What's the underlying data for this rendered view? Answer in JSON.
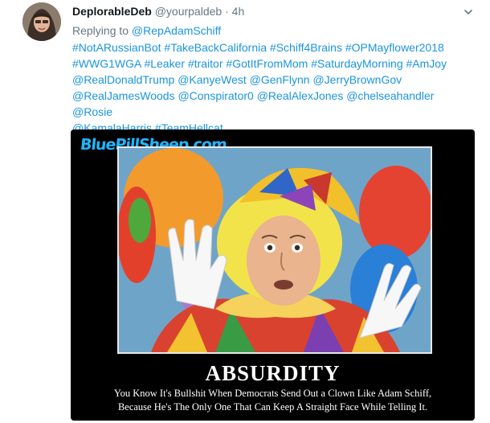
{
  "tweet": {
    "display_name": "DeplorableDeb",
    "handle": "@yourpaldeb",
    "separator": "·",
    "time": "4h",
    "caret_icon": "chevron-down-icon",
    "replying_prefix": "Replying to",
    "replying_to": "@RepAdamSchiff",
    "lines": [
      [
        {
          "t": "#NotARussianBot",
          "k": "hash"
        },
        {
          "t": "#TakeBackCalifornia",
          "k": "hash"
        },
        {
          "t": "#Schiff4Brains",
          "k": "hash"
        },
        {
          "t": "#OPMayflower2018",
          "k": "hash"
        }
      ],
      [
        {
          "t": "#WWG1WGA",
          "k": "hash"
        },
        {
          "t": "#Leaker",
          "k": "hash"
        },
        {
          "t": "#traitor",
          "k": "hash"
        },
        {
          "t": "#GotItFromMom",
          "k": "hash"
        },
        {
          "t": "#SaturdayMorning",
          "k": "hash"
        },
        {
          "t": "#AmJoy",
          "k": "hash"
        }
      ],
      [
        {
          "t": "@RealDonaldTrump",
          "k": "mention"
        },
        {
          "t": "@KanyeWest",
          "k": "mention"
        },
        {
          "t": "@GenFlynn",
          "k": "mention"
        },
        {
          "t": "@JerryBrownGov",
          "k": "mention"
        }
      ],
      [
        {
          "t": "@RealJamesWoods",
          "k": "mention"
        },
        {
          "t": "@Conspirator0",
          "k": "mention"
        },
        {
          "t": "@RealAlexJones",
          "k": "mention"
        },
        {
          "t": "@chelseahandler",
          "k": "mention"
        },
        {
          "t": "@Rosie",
          "k": "mention"
        }
      ],
      [
        {
          "t": "@KamalaHarris",
          "k": "mention"
        },
        {
          "t": "#TeamHellcat",
          "k": "hash"
        }
      ]
    ]
  },
  "media": {
    "site_label": "BluePillSheep.com",
    "poster_title": "ABSURDITY",
    "caption_line1": "You Know It's Bullshit When Democrats Send Out a Clown Like Adam Schiff,",
    "caption_line2": "Because He's The Only One That Can Keep A Straight Face While Telling It."
  },
  "colors": {
    "link": "#1b95e0",
    "muted": "#657786",
    "text": "#14171a",
    "site_label": "#1fb6ff"
  }
}
